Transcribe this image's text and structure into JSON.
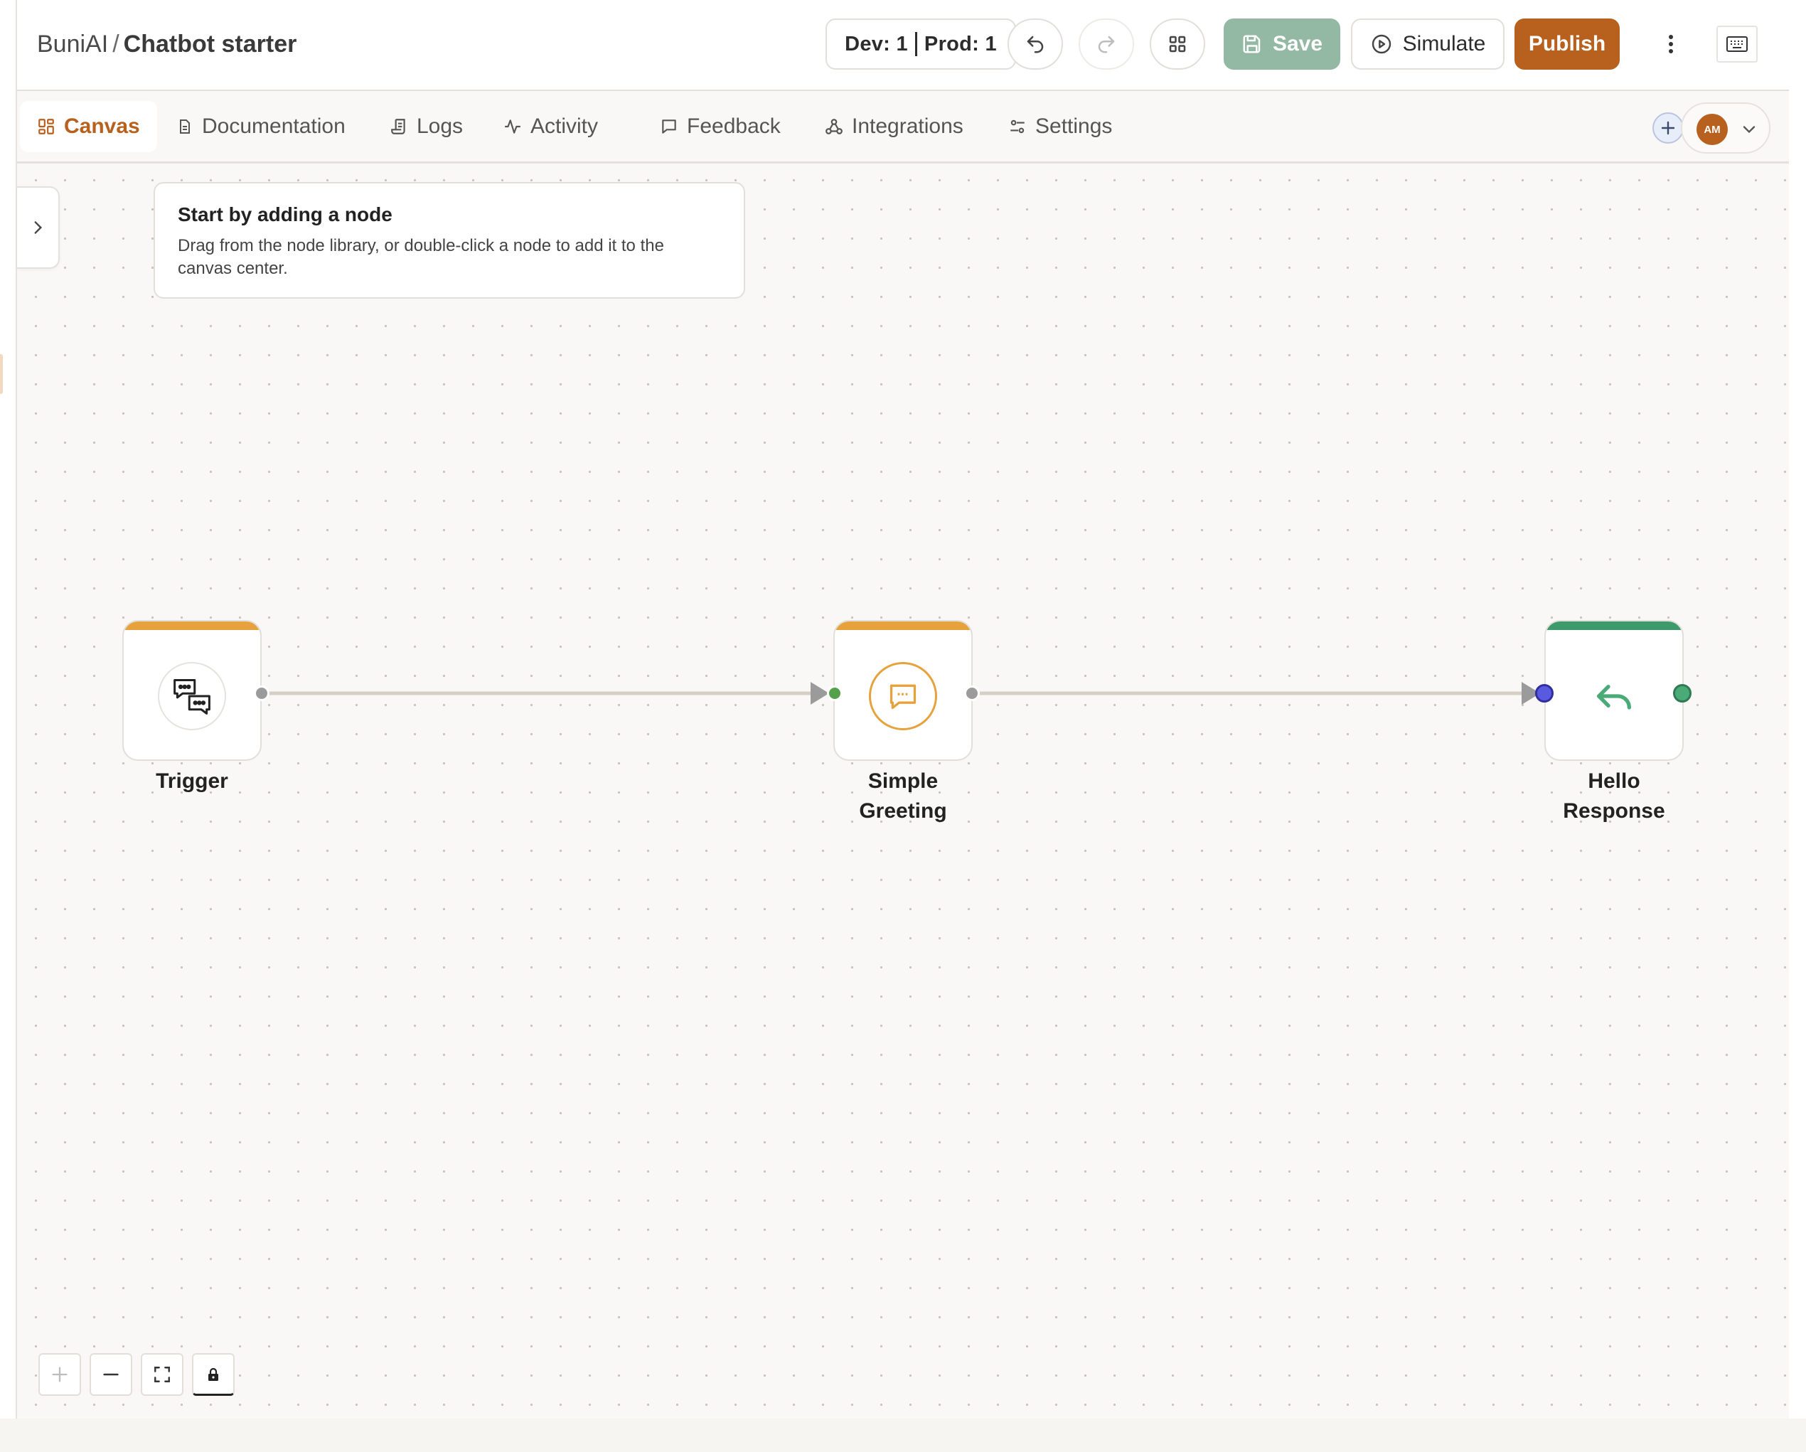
{
  "header": {
    "org": "BuniAI",
    "separator": "/",
    "project": "Chatbot starter",
    "version_dev": "Dev: 1",
    "version_prod": "Prod: 1",
    "save_label": "Save",
    "simulate_label": "Simulate",
    "publish_label": "Publish"
  },
  "tabs": [
    {
      "label": "Canvas",
      "icon": "canvas-grid-icon",
      "active": true
    },
    {
      "label": "Documentation",
      "icon": "document-icon",
      "active": false
    },
    {
      "label": "Logs",
      "icon": "logs-icon",
      "active": false
    },
    {
      "label": "Activity",
      "icon": "activity-icon",
      "active": false
    },
    {
      "label": "Feedback",
      "icon": "feedback-icon",
      "active": false
    },
    {
      "label": "Integrations",
      "icon": "integrations-icon",
      "active": false
    },
    {
      "label": "Settings",
      "icon": "settings-icon",
      "active": false
    }
  ],
  "user": {
    "initials": "AM"
  },
  "hint": {
    "title": "Start by adding a node",
    "body": "Drag from the node library, or double-click a node to add it to the canvas center."
  },
  "nodes": [
    {
      "label": "Trigger",
      "icon": "chat-bubbles-icon",
      "accent": "#e6a23c"
    },
    {
      "label_line1": "Simple",
      "label_line2": "Greeting",
      "icon": "message-icon",
      "accent": "#e6a23c"
    },
    {
      "label_line1": "Hello",
      "label_line2": "Response",
      "icon": "reply-icon",
      "accent": "#3f9a6b"
    }
  ],
  "colors": {
    "brand": "#b8601e",
    "save_disabled": "#93b8a4",
    "port_gray": "#9b9b9b",
    "port_green": "#55a04a",
    "port_blue": "#5a5ae0",
    "edge": "#d6cfc7"
  }
}
